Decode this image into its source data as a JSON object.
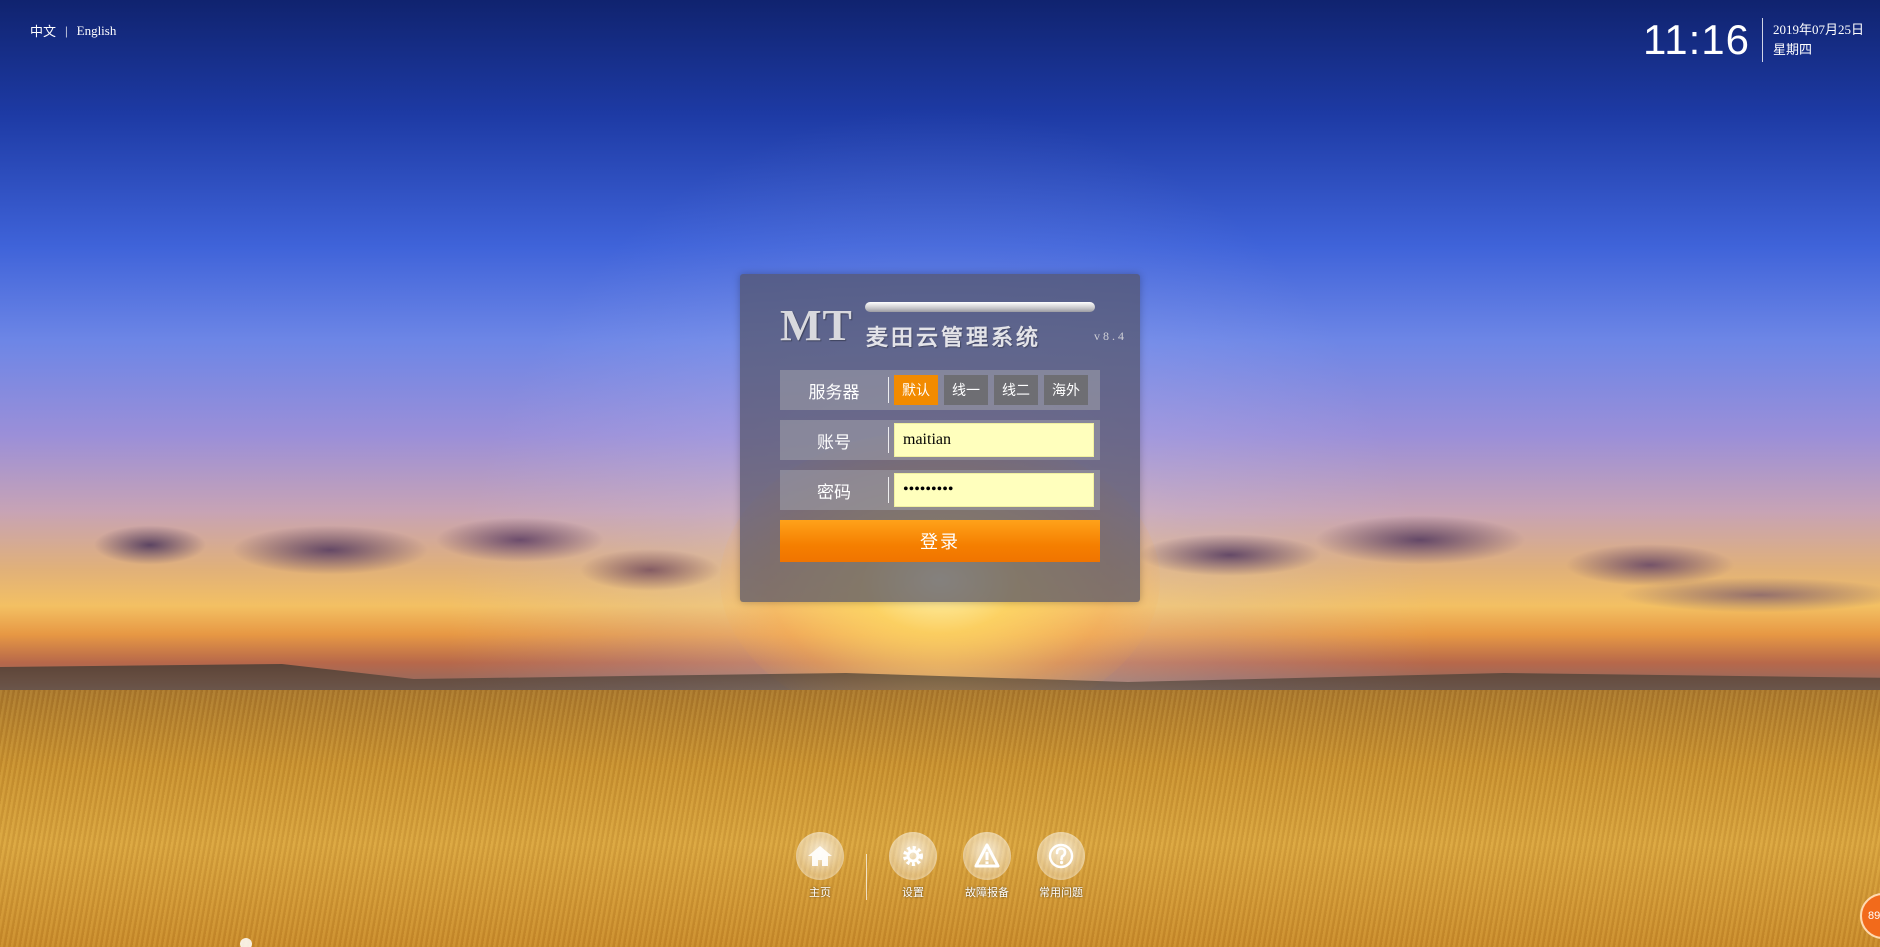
{
  "language": {
    "chinese": "中文",
    "separator": "|",
    "english": "English"
  },
  "clock": {
    "time": "11:16",
    "date": "2019年07月25日",
    "weekday": "星期四"
  },
  "brand": {
    "logo": "MT",
    "name": "麦田云管理系统",
    "version": "v8.4"
  },
  "form": {
    "server_label": "服务器",
    "servers": [
      "默认",
      "线一",
      "线二",
      "海外"
    ],
    "active_server": "默认",
    "account_label": "账号",
    "account_value": "maitian",
    "password_label": "密码",
    "password_value": "maitian88",
    "login_button": "登录"
  },
  "dock": {
    "home": {
      "label": "主页",
      "icon": "home-icon"
    },
    "settings": {
      "label": "设置",
      "icon": "gear-icon"
    },
    "report": {
      "label": "故障报备",
      "icon": "warning-icon"
    },
    "faq": {
      "label": "常用问题",
      "icon": "question-icon"
    }
  },
  "corner_badge": "89",
  "colors": {
    "accent": "#f28b00",
    "input_bg": "#ffffbd",
    "panel": "#55556a"
  }
}
